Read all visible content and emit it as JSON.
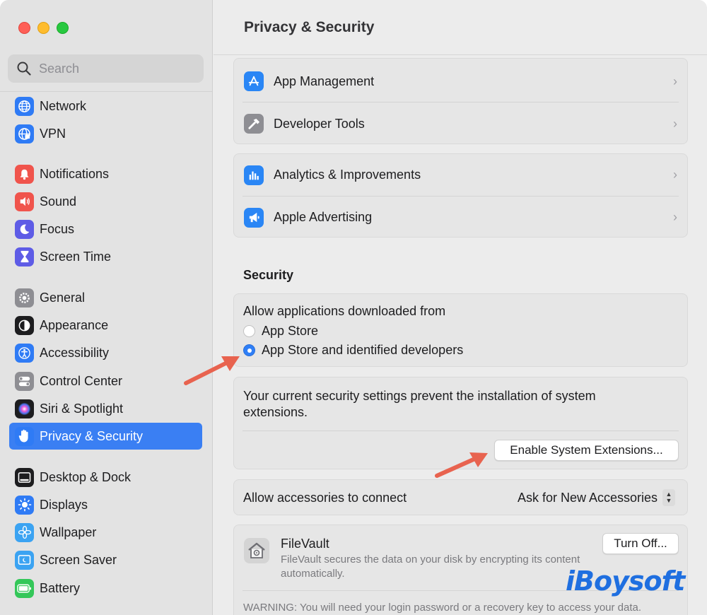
{
  "sidebar": {
    "search_placeholder": "Search",
    "items": [
      {
        "label": "Network",
        "icon": "globe-icon",
        "color": "#2f7bf5"
      },
      {
        "label": "VPN",
        "icon": "globe-vpn-icon",
        "color": "#2f7bf5"
      },
      {
        "label": "Notifications",
        "icon": "bell-icon",
        "color": "#f0544c"
      },
      {
        "label": "Sound",
        "icon": "speaker-icon",
        "color": "#f0544c"
      },
      {
        "label": "Focus",
        "icon": "moon-icon",
        "color": "#5e5ce6"
      },
      {
        "label": "Screen Time",
        "icon": "hourglass-icon",
        "color": "#5e5ce6"
      },
      {
        "label": "General",
        "icon": "gear-icon",
        "color": "#8e8e93"
      },
      {
        "label": "Appearance",
        "icon": "appearance-icon",
        "color": "#1d1d1f"
      },
      {
        "label": "Accessibility",
        "icon": "accessibility-icon",
        "color": "#2f7bf5"
      },
      {
        "label": "Control Center",
        "icon": "toggles-icon",
        "color": "#8e8e93"
      },
      {
        "label": "Siri & Spotlight",
        "icon": "siri-icon",
        "color": "#6e3bd8"
      },
      {
        "label": "Privacy & Security",
        "icon": "hand-icon",
        "color": "#2f7bf5"
      },
      {
        "label": "Desktop & Dock",
        "icon": "dock-icon",
        "color": "#1d1d1f"
      },
      {
        "label": "Displays",
        "icon": "sun-icon",
        "color": "#2f7bf5"
      },
      {
        "label": "Wallpaper",
        "icon": "flower-icon",
        "color": "#3ba3f2"
      },
      {
        "label": "Screen Saver",
        "icon": "screensaver-icon",
        "color": "#3ba3f2"
      },
      {
        "label": "Battery",
        "icon": "battery-icon",
        "color": "#34c759"
      }
    ],
    "selected": "Privacy & Security"
  },
  "main": {
    "title": "Privacy & Security",
    "group1": [
      {
        "label": "App Management",
        "icon": "app-store-icon"
      },
      {
        "label": "Developer Tools",
        "icon": "hammer-icon"
      }
    ],
    "group2": [
      {
        "label": "Analytics & Improvements",
        "icon": "chart-icon"
      },
      {
        "label": "Apple Advertising",
        "icon": "megaphone-icon"
      }
    ],
    "chevron": "›",
    "security": {
      "heading": "Security",
      "allow_label": "Allow applications downloaded from",
      "option1": "App Store",
      "option2": "App Store and identified developers",
      "selected_option": "App Store and identified developers",
      "extensions_text": "Your current security settings prevent the installation of system extensions.",
      "enable_button": "Enable System Extensions...",
      "accessories_label": "Allow accessories to connect",
      "accessories_value": "Ask for New Accessories",
      "filevault_title": "FileVault",
      "filevault_desc": "FileVault secures the data on your disk by encrypting its content automatically.",
      "turn_off_button": "Turn Off...",
      "warning": "WARNING: You will need your login password or a recovery key to access your data."
    }
  },
  "watermark": "iBoysoft",
  "colors": {
    "accent": "#3a7ff3",
    "arrow": "#e8634f"
  }
}
